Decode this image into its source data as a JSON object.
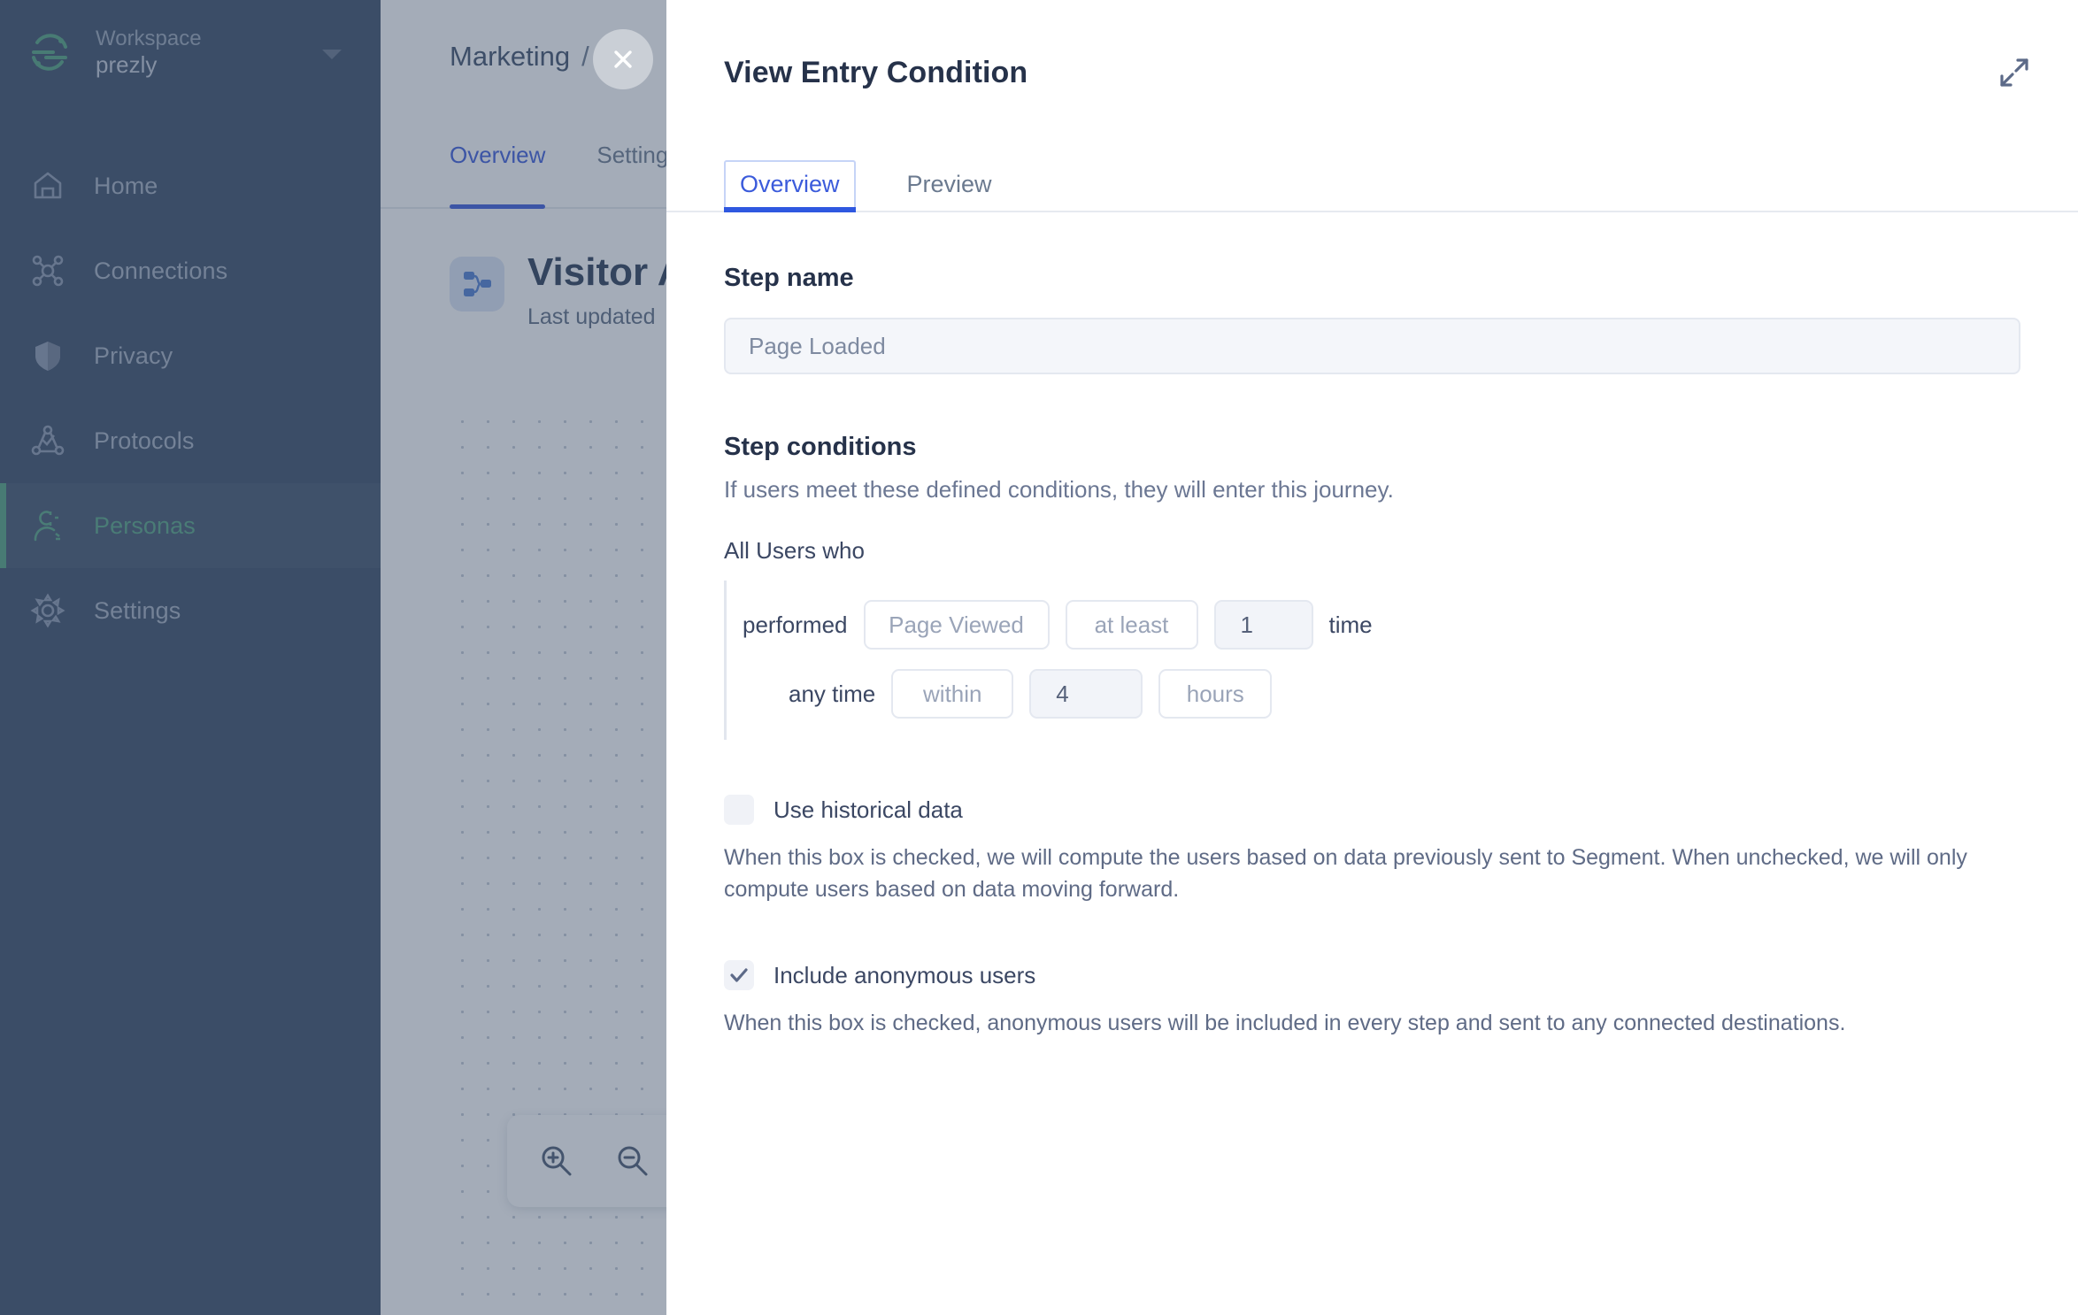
{
  "sidebar": {
    "workspace_label": "Workspace",
    "workspace_name": "prezly",
    "items": [
      {
        "label": "Home",
        "icon": "home-icon",
        "active": false
      },
      {
        "label": "Connections",
        "icon": "connections-icon",
        "active": false
      },
      {
        "label": "Privacy",
        "icon": "shield-icon",
        "active": false
      },
      {
        "label": "Protocols",
        "icon": "protocols-icon",
        "active": false
      },
      {
        "label": "Personas",
        "icon": "personas-icon",
        "active": true
      },
      {
        "label": "Settings",
        "icon": "gear-icon",
        "active": false
      }
    ],
    "bg_color": "#3a4c66",
    "active_accent": "#52a37f"
  },
  "background_page": {
    "breadcrumb_first": "Marketing",
    "breadcrumb_sep": "/",
    "tabs": [
      {
        "label": "Overview",
        "active": true
      },
      {
        "label": "Settings",
        "active": false
      }
    ],
    "journey_title": "Visitor A",
    "journey_subtitle": "Last updated",
    "zoom_in_icon": "zoom-in-icon",
    "zoom_out_icon": "zoom-out-icon"
  },
  "modal": {
    "title": "View Entry Condition",
    "close_icon": "close-icon",
    "expand_icon": "expand-icon",
    "tabs": [
      {
        "label": "Overview",
        "active": true
      },
      {
        "label": "Preview",
        "active": false
      }
    ],
    "step_name": {
      "heading": "Step name",
      "value": "Page Loaded"
    },
    "step_conditions": {
      "heading": "Step conditions",
      "description": "If users meet these defined conditions, they will enter this journey.",
      "audience_label": "All Users who",
      "row1": {
        "verb": "performed",
        "event": "Page Viewed",
        "operator": "at least",
        "count": "1",
        "unit": "time"
      },
      "row2": {
        "timeframe": "any time",
        "window": "within",
        "amount": "4",
        "period": "hours"
      }
    },
    "historical": {
      "label": "Use historical data",
      "checked": false,
      "description": "When this box is checked, we will compute the users based on data previously sent to Segment. When unchecked, we will only compute users based on data moving forward."
    },
    "anonymous": {
      "label": "Include anonymous users",
      "checked": true,
      "description": "When this box is checked, anonymous users will be included in every step and sent to any connected destinations."
    }
  },
  "colors": {
    "accent_blue": "#3b5bdb",
    "sidebar_bg": "#3a4c66",
    "active_green": "#52a37f",
    "text_dark": "#26324a",
    "text_muted": "#6b7793"
  }
}
